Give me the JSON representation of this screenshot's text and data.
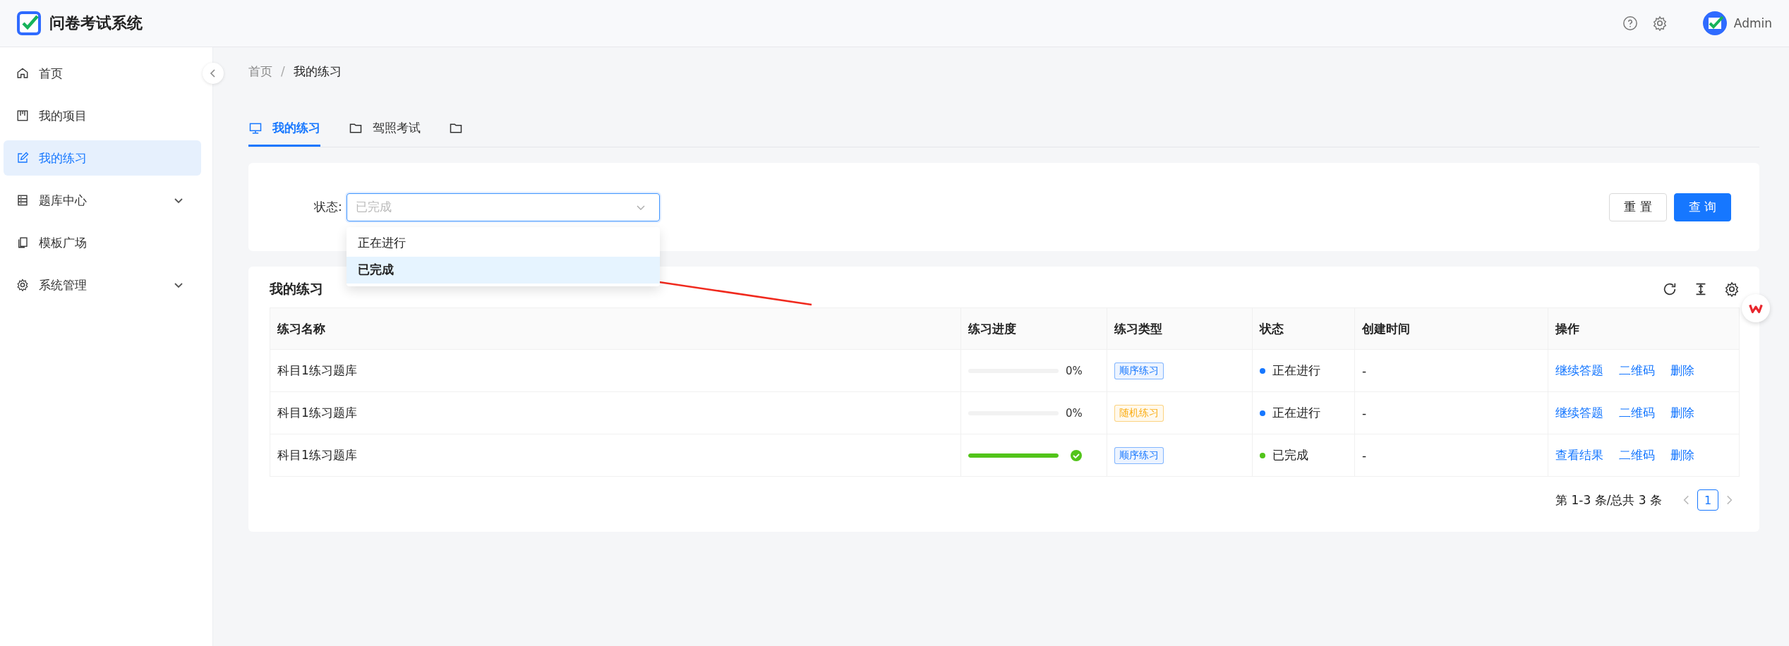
{
  "header": {
    "app_title": "问卷考试系统",
    "user": "Admin"
  },
  "sidebar": {
    "items": [
      {
        "label": "首页",
        "kind": "home",
        "selected": false,
        "expandable": false
      },
      {
        "label": "我的项目",
        "kind": "board",
        "selected": false,
        "expandable": false
      },
      {
        "label": "我的练习",
        "kind": "edit",
        "selected": true,
        "expandable": false
      },
      {
        "label": "题库中心",
        "kind": "list",
        "selected": false,
        "expandable": true
      },
      {
        "label": "模板广场",
        "kind": "copy",
        "selected": false,
        "expandable": false
      },
      {
        "label": "系统管理",
        "kind": "gear",
        "selected": false,
        "expandable": true
      }
    ]
  },
  "breadcrumb": {
    "items": [
      "首页",
      "我的练习"
    ],
    "separator": "/"
  },
  "tabs": [
    {
      "label": "我的练习",
      "kind": "monitor",
      "selected": true
    },
    {
      "label": "驾照考试",
      "kind": "folder",
      "selected": false
    },
    {
      "kind": "folder",
      "selected": false
    }
  ],
  "filter": {
    "label": "状态:",
    "select": {
      "value": "已完成",
      "open": true,
      "options": [
        {
          "label": "正在进行",
          "selected": false
        },
        {
          "label": "已完成",
          "selected": true
        }
      ]
    },
    "buttons": [
      {
        "label": "重 置",
        "kind": "default"
      },
      {
        "label": "查 询",
        "kind": "primary"
      }
    ]
  },
  "table": {
    "title": "我的练习",
    "columns": [
      "练习名称",
      "练习进度",
      "练习类型",
      "状态",
      "创建时间",
      "操作"
    ],
    "rows": [
      {
        "name": "科目1练习题库",
        "progress": {
          "level": 0,
          "reading": "0%",
          "done": false
        },
        "type": {
          "label": "顺序练习",
          "color": "#1677ff"
        },
        "status": {
          "label": "正在进行",
          "color": "#1677ff"
        },
        "created": "-",
        "actions": [
          "继续答题",
          "二维码",
          "删除"
        ]
      },
      {
        "name": "科目1练习题库",
        "progress": {
          "level": 0,
          "reading": "0%",
          "done": false
        },
        "type": {
          "label": "随机练习",
          "color": "#faad14"
        },
        "status": {
          "label": "正在进行",
          "color": "#1677ff"
        },
        "created": "-",
        "actions": [
          "继续答题",
          "二维码",
          "删除"
        ]
      },
      {
        "name": "科目1练习题库",
        "progress": {
          "level": 1,
          "done": true
        },
        "type": {
          "label": "顺序练习",
          "color": "#1677ff"
        },
        "status": {
          "label": "已完成",
          "color": "#52c41a"
        },
        "created": "-",
        "actions": [
          "查看结果",
          "二维码",
          "删除"
        ]
      }
    ]
  },
  "pagination": {
    "summary": "第 1-3 条/总共 3 条",
    "pages": [
      {
        "label": "1",
        "selected": true
      }
    ]
  }
}
